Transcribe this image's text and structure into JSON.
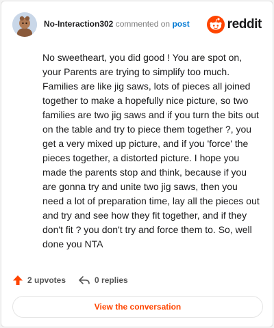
{
  "header": {
    "username": "No-Interaction302",
    "action_text": "commented on",
    "post_link": "post",
    "logo_text": "reddit",
    "avatar_icon": "snoo-avatar-icon",
    "logo_icon": "reddit-snoo-icon"
  },
  "comment": {
    "body": "No sweetheart, you did good ! You are spot on, your Parents are trying to simplify too much. Families are like jig saws, lots of pieces all joined together to make a hopefully nice picture, so two families are two jig saws and if you turn the bits out on the table and try to piece them together ?, you get a very mixed up picture, and if you 'force' the pieces together, a distorted picture. I hope you made the parents stop and think, because if you are gonna try and unite two jig saws, then you need a lot of preparation time, lay all the pieces out and try and see how they fit together, and if they don't fit ? you don't try and force them to. So, well done you NTA"
  },
  "actions": {
    "upvotes": "2 upvotes",
    "replies": "0 replies",
    "upvote_icon": "upvote-arrow-icon",
    "reply_icon": "reply-arrow-icon"
  },
  "cta": {
    "label": "View the conversation"
  },
  "colors": {
    "brand": "#ff4500",
    "link": "#0079d3",
    "text": "#1a1a1b"
  }
}
